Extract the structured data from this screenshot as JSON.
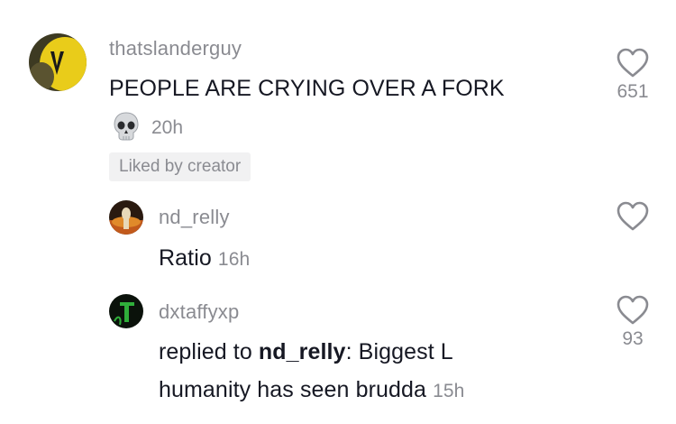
{
  "comments": [
    {
      "username": "thatslanderguy",
      "text": "PEOPLE ARE CRYING OVER A FORK",
      "emoji": "skull",
      "time": "20h",
      "likes": "651",
      "badge": "Liked by creator"
    }
  ],
  "replies": [
    {
      "username": "nd_relly",
      "text": "Ratio",
      "time": "16h",
      "likes": ""
    },
    {
      "username": "dxtaffyxp",
      "prefix": "replied to ",
      "replied_to": "nd_relly",
      "text_line1": ": Biggest L",
      "text_line2": "humanity has seen brudda",
      "time": "15h",
      "likes": "93"
    }
  ],
  "icons": {
    "like": "heart-outline-icon",
    "skull": "skull-emoji-icon"
  },
  "colors": {
    "text": "#161823",
    "secondary": "#8a8b91",
    "badge_bg": "#f1f1f2"
  }
}
